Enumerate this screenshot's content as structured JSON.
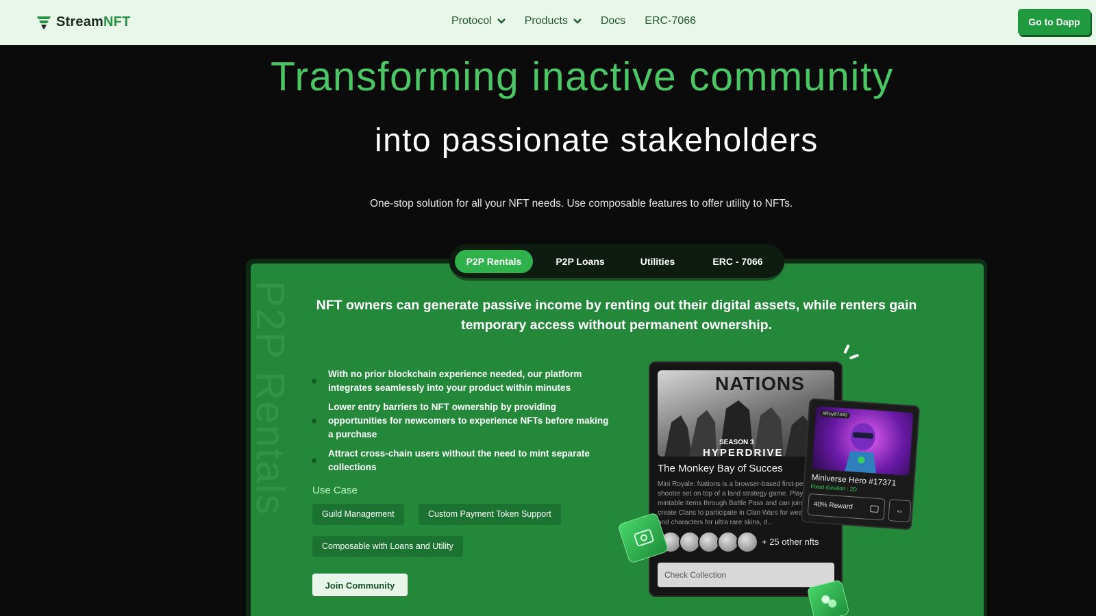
{
  "nav": {
    "logo_text_prefix": "Stream",
    "logo_text_suffix": "NFT",
    "links": [
      {
        "label": "Protocol",
        "dropdown": true
      },
      {
        "label": "Products",
        "dropdown": true
      },
      {
        "label": "Docs",
        "dropdown": false
      },
      {
        "label": "ERC-7066",
        "dropdown": false
      }
    ],
    "cta_label": "Go to Dapp"
  },
  "hero": {
    "title_line1": "Transforming inactive community",
    "title_line2": "into passionate stakeholders",
    "subtitle": "One-stop solution for all your NFT needs. Use composable features to offer utility to NFTs."
  },
  "tabs": [
    {
      "label": "P2P Rentals",
      "active": true
    },
    {
      "label": "P2P Loans",
      "active": false
    },
    {
      "label": "Utilities",
      "active": false
    },
    {
      "label": "ERC - 7066",
      "active": false
    }
  ],
  "panel": {
    "vertical_label": "P2P Rentals",
    "heading": "NFT owners can generate passive income by renting out their digital assets, while renters gain temporary access without permanent ownership.",
    "bullets": [
      "With no prior blockchain experience needed, our platform integrates seamlessly into your product within minutes",
      "Lower entry barriers to NFT ownership by providing opportunities for newcomers to experience NFTs before making a purchase",
      "Attract cross-chain users without the need to mint separate collections"
    ],
    "use_case_label": "Use Case",
    "use_cases": [
      "Guild Management",
      "Custom Payment Token Support",
      "Composable with Loans and Utility"
    ],
    "join_label": "Join Community"
  },
  "collection_card": {
    "image_brand": "NATIONS",
    "image_season": "SEASON 3",
    "image_subtitle": "HYPERDRIVE",
    "title": "The Monkey Bay of Succes",
    "description": "Mini Royale: Nations is a browser-based first-person shooter set on top of a land strategy game. Players earn mintable items through Battle Pass and can join or create Clans to participate in Clan Wars for weapons and characters for ultra rare skins, d...",
    "more_nfts": "+ 25 other nfts",
    "check_label": "Check Collection"
  },
  "nft_card": {
    "tag": "#Roy87390",
    "title": "Miniverse Hero #17371",
    "subtitle": "Fixed duration : 2D",
    "reward": "40% Reward",
    "swap_symbol": "⇔"
  },
  "colors": {
    "brand_green": "#24883b",
    "title_green": "#4cc664",
    "nav_bg": "#e9f6ea",
    "page_bg": "#0b0b0b"
  }
}
